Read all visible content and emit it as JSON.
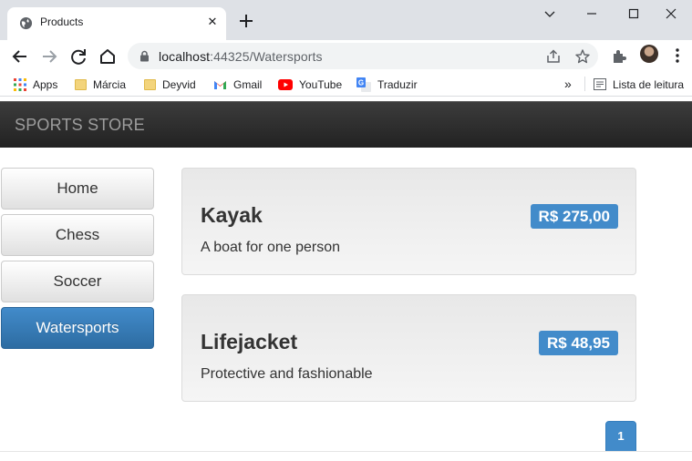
{
  "browser": {
    "tab_title": "Products",
    "tab_close": "✕",
    "url_host": "localhost",
    "url_rest": ":44325/Watersports",
    "bookmarks": [
      {
        "label": "Apps",
        "icon": "apps-grid-icon"
      },
      {
        "label": "Márcia",
        "icon": "folder-icon"
      },
      {
        "label": "Deyvid",
        "icon": "folder-icon"
      },
      {
        "label": "Gmail",
        "icon": "gmail-icon"
      },
      {
        "label": "YouTube",
        "icon": "youtube-icon"
      },
      {
        "label": "Traduzir",
        "icon": "google-translate-icon"
      }
    ],
    "overflow": "»",
    "reading_list": "Lista de leitura"
  },
  "site": {
    "brand": "SPORTS STORE",
    "categories": [
      {
        "label": "Home",
        "active": false
      },
      {
        "label": "Chess",
        "active": false
      },
      {
        "label": "Soccer",
        "active": false
      },
      {
        "label": "Watersports",
        "active": true
      }
    ],
    "products": [
      {
        "name": "Kayak",
        "price": "R$ 275,00",
        "description": "A boat for one person"
      },
      {
        "name": "Lifejacket",
        "price": "R$ 48,95",
        "description": "Protective and fashionable"
      }
    ],
    "pagination": {
      "current": "1"
    }
  },
  "colors": {
    "accent": "#428bca",
    "navbar": "#222222",
    "chrome_tabstrip": "#dee1e6"
  }
}
